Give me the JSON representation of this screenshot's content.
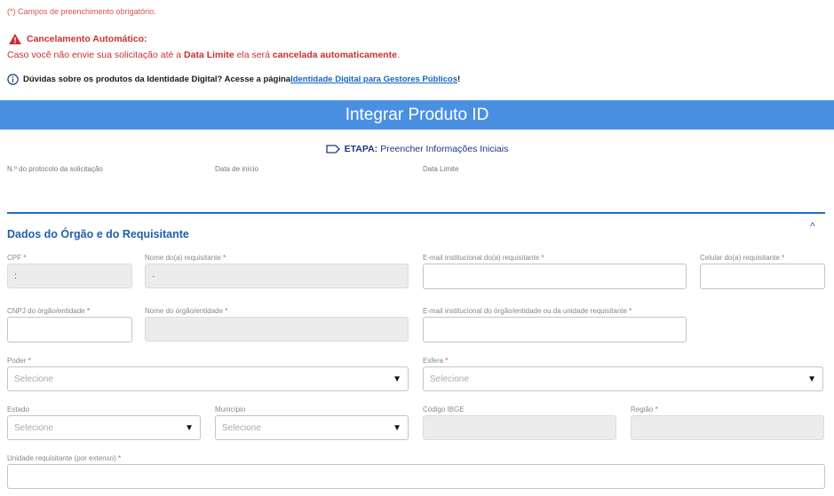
{
  "notes": {
    "required": "(*) Campos de preenchimento obrigatório."
  },
  "warning": {
    "title": "Cancelamento Automático:",
    "text_1": "Caso você não envie sua solicitação até a ",
    "bold_1": "Data Limite",
    "text_2": " ela será ",
    "bold_2": "cancelada automaticamente",
    "text_3": "."
  },
  "info": {
    "text": "Dúvidas sobre os produtos da Identidade Digital? Acesse a página ",
    "link": "Identidade Digital para Gestores Públicos",
    "suffix": "!"
  },
  "banner": {
    "title": "Integrar Produto ID"
  },
  "etapa": {
    "label": "ETAPA:",
    "value": "Preencher Informações Iniciais"
  },
  "meta": {
    "protocolo": "N.º do protocolo da solicitação",
    "inicio": "Data de início",
    "limite": "Data Limite"
  },
  "section": {
    "title": "Dados do Órgão e do Requisitante",
    "collapse_glyph": "^"
  },
  "form": {
    "required_mark": "*",
    "cpf": {
      "label": "CPF",
      "value": ":"
    },
    "nome_req": {
      "label": "Nome do(a) requisitante",
      "value": "·"
    },
    "email_req": {
      "label": "E-mail institucional do(a) requisitante",
      "value": ""
    },
    "celular": {
      "label": "Celular do(a) requisitante",
      "value": ""
    },
    "cnpj": {
      "label": "CNPJ do órgão/entidade",
      "value": ""
    },
    "nome_orgao": {
      "label": "Nome do órgão/entidade",
      "value": ""
    },
    "email_orgao": {
      "label": "E-mail institucional do órgão/entidade ou da unidade requisitante",
      "value": ""
    },
    "poder": {
      "label": "Poder",
      "value": "Selecione"
    },
    "esfera": {
      "label": "Esfera",
      "value": "Selecione"
    },
    "estado": {
      "label": "Estado",
      "value": "Selecione"
    },
    "municipio": {
      "label": "Município",
      "value": "Selecione"
    },
    "ibge": {
      "label": "Código IBGE",
      "value": ""
    },
    "regiao": {
      "label": "Região",
      "value": ""
    },
    "unidade": {
      "label": "Unidade requisitante (por extenso)",
      "value": ""
    },
    "dropdown_arrow": "▼"
  },
  "colors": {
    "banner": "#4a90e2",
    "warning": "#c9302c",
    "section": "#1f5fae"
  }
}
